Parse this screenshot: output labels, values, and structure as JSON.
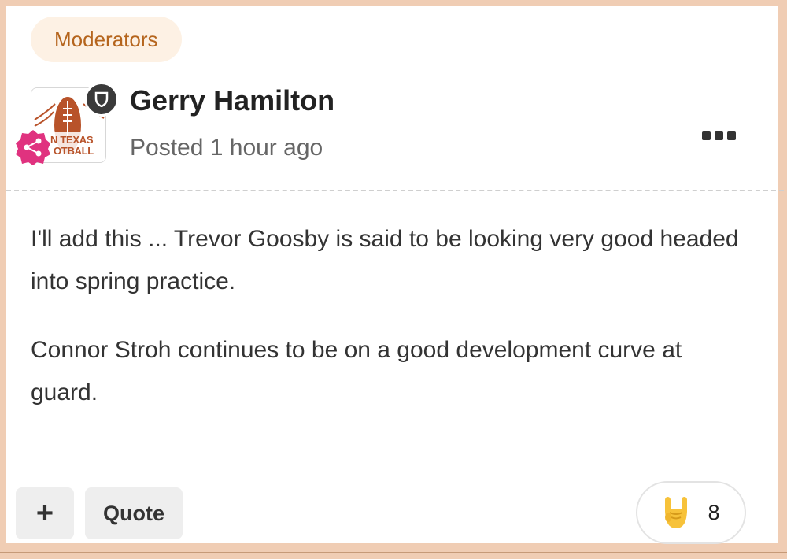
{
  "group_badge": "Moderators",
  "author": {
    "name": "Gerry Hamilton",
    "posted": "Posted 1 hour ago",
    "avatar_text_line1": "N TEXAS",
    "avatar_text_line2": "OTBALL"
  },
  "post": {
    "paragraphs": [
      "I'll add this ... Trevor Goosby is said to be looking very good headed into spring practice.",
      "Connor Stroh continues to be on a good development curve at guard."
    ]
  },
  "actions": {
    "plus_label": "+",
    "quote_label": "Quote"
  },
  "reactions": {
    "icon": "rock-on-hand-icon",
    "count": "8"
  },
  "colors": {
    "page_border": "#f0cdb4",
    "badge_bg": "#fdf1e4",
    "badge_text": "#b5651d",
    "share_badge": "#e0327f",
    "moderator_badge": "#3a3a3a"
  }
}
